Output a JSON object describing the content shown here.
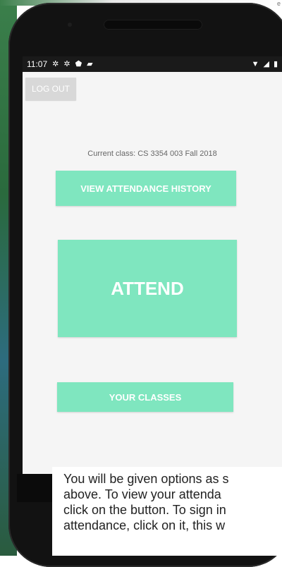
{
  "background": {
    "top_right_text": "e"
  },
  "status_bar": {
    "time": "11:07",
    "icons_left": [
      "gear-icon",
      "gear-icon",
      "shield-icon",
      "sd-card-icon"
    ],
    "icons_right": [
      "wifi-icon",
      "signal-icon",
      "battery-icon"
    ]
  },
  "app": {
    "logout_label": "LOG OUT",
    "current_class_text": "Current class: CS 3354 003 Fall 2018",
    "view_history_label": "VIEW ATTENDANCE HISTORY",
    "attend_label": "ATTEND",
    "your_classes_label": "YOUR CLASSES"
  },
  "caption": {
    "line1": "You will be given options as s",
    "line2": "above. To view your attenda",
    "line3": "click on the button. To sign in",
    "line4": "attendance, click on it, this w"
  },
  "colors": {
    "accent_green": "#7fe6bf",
    "logout_gray": "#d8d8d8",
    "statusbar": "#1a1a1a"
  }
}
